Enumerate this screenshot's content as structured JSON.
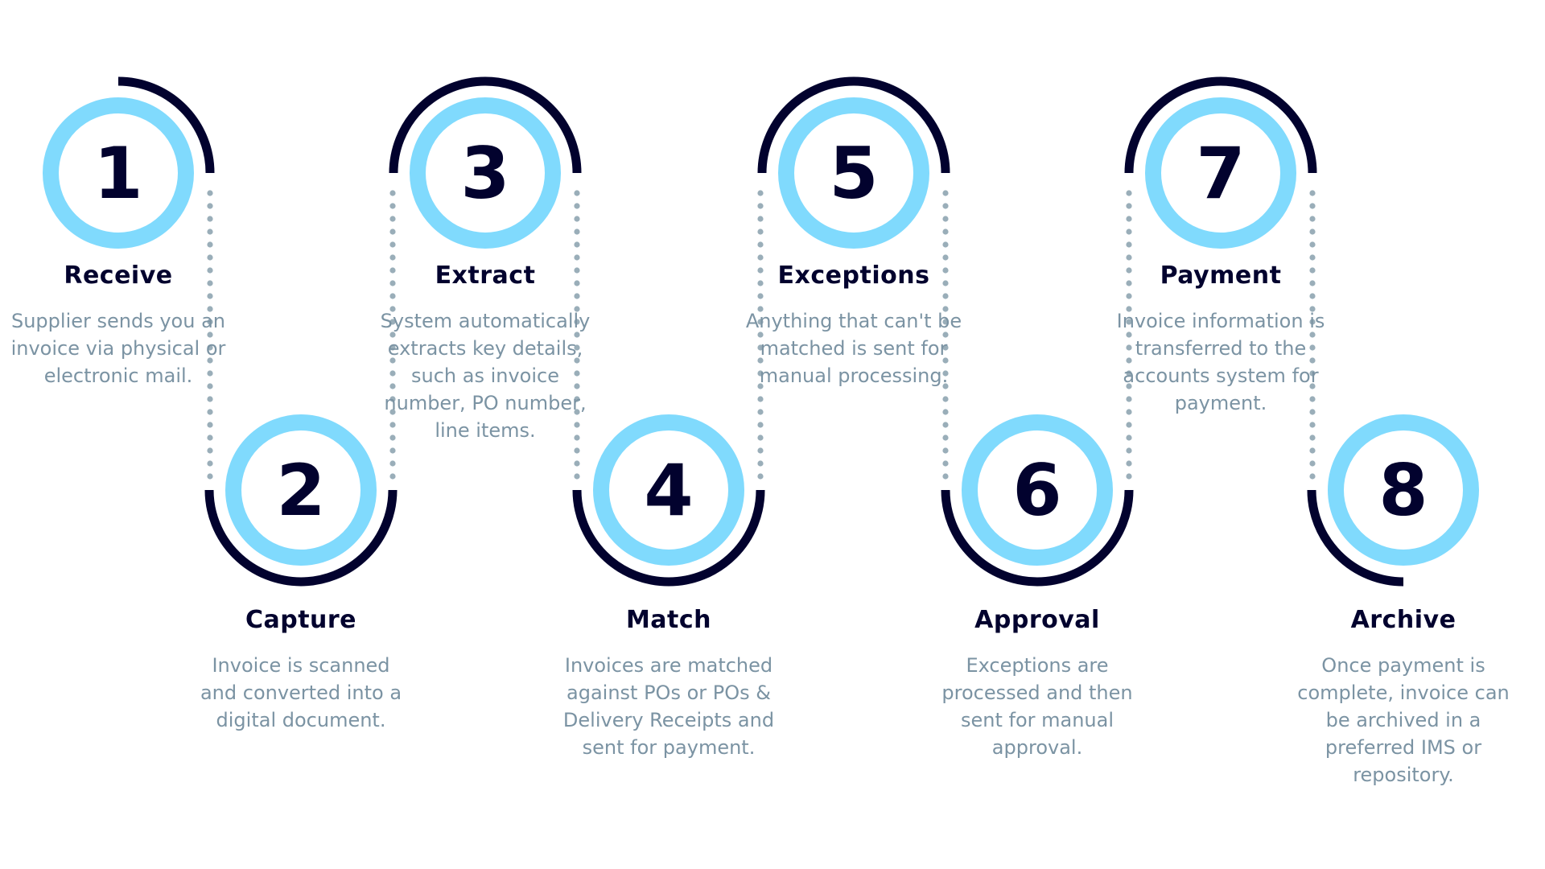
{
  "colors": {
    "ring": "#80dafd",
    "arc": "#02022e",
    "dots": "#9aaeb9",
    "title": "#02022e",
    "text": "#7b93a3"
  },
  "steps": [
    {
      "number": "1",
      "title": "Receive",
      "description": "Supplier sends you an invoice via physical or electronic mail."
    },
    {
      "number": "2",
      "title": "Capture",
      "description": "Invoice is scanned and converted into a digital document."
    },
    {
      "number": "3",
      "title": "Extract",
      "description": "System automatically extracts key details, such as invoice number, PO number, line items."
    },
    {
      "number": "4",
      "title": "Match",
      "description": "Invoices are matched against POs or POs & Delivery Receipts and sent for payment."
    },
    {
      "number": "5",
      "title": "Exceptions",
      "description": "Anything that can't be matched is sent for manual processing."
    },
    {
      "number": "6",
      "title": "Approval",
      "description": "Exceptions are processed and then sent for manual approval."
    },
    {
      "number": "7",
      "title": "Payment",
      "description": "Invoice information is transferred to the accounts system for payment."
    },
    {
      "number": "8",
      "title": "Archive",
      "description": "Once payment is complete, invoice can be archived in a preferred IMS or repository."
    }
  ]
}
